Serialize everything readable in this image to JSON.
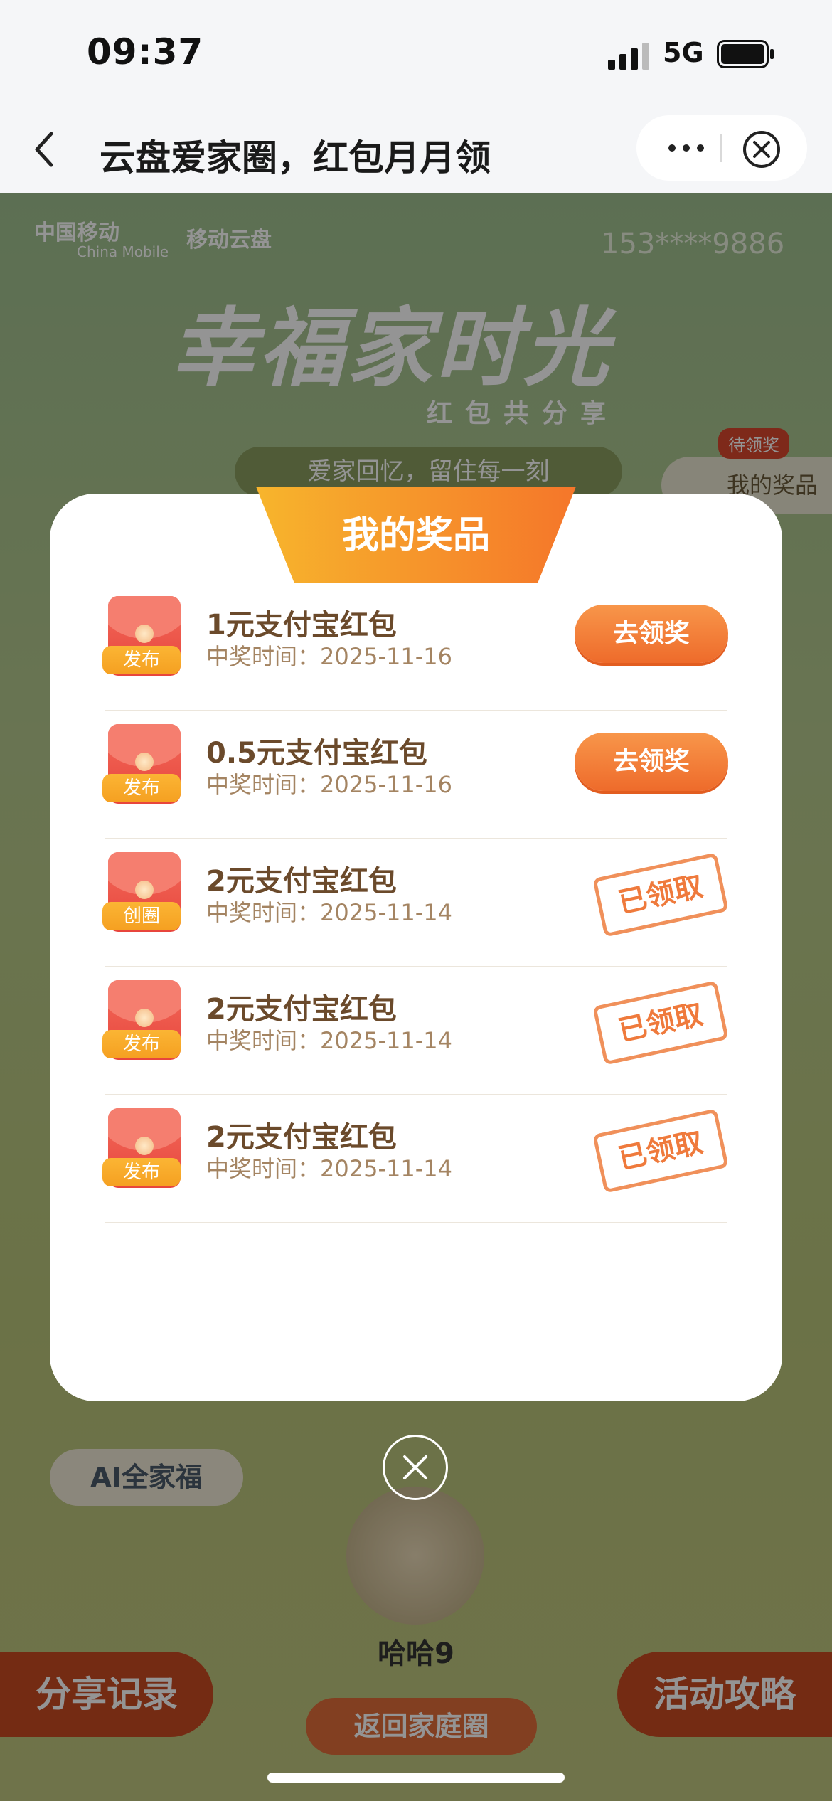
{
  "status_bar": {
    "time": "09:37",
    "network": "5G"
  },
  "nav": {
    "title": "云盘爱家圈，红包月月领"
  },
  "background": {
    "logo_main": "中国移动",
    "logo_main_en": "China Mobile",
    "logo_app": "移动云盘",
    "phone": "153****9886",
    "hero_title": "幸福家时光",
    "hero_subtitle": "红包共分享",
    "memory_banner": "爱家回忆，留住每一刻",
    "prize_tag": "待领奖",
    "prize_entry": "我的奖品",
    "ai_button": "AI全家福",
    "avatar_name": "哈哈9",
    "share_button": "分享记录",
    "guide_button": "活动攻略",
    "return_button": "返回家庭圈"
  },
  "modal": {
    "title": "我的奖品",
    "items": [
      {
        "tag": "发布",
        "name": "1元支付宝红包",
        "time": "中奖时间：2025-11-16",
        "action": "去领奖"
      },
      {
        "tag": "发布",
        "name": "0.5元支付宝红包",
        "time": "中奖时间：2025-11-16",
        "action": "去领奖"
      },
      {
        "tag": "创圈",
        "name": "2元支付宝红包",
        "time": "中奖时间：2025-11-14",
        "status": "已领取"
      },
      {
        "tag": "发布",
        "name": "2元支付宝红包",
        "time": "中奖时间：2025-11-14",
        "status": "已领取"
      },
      {
        "tag": "发布",
        "name": "2元支付宝红包",
        "time": "中奖时间：2025-11-14",
        "status": "已领取"
      }
    ]
  },
  "icons": [
    "back-arrow-icon",
    "more-dots-icon",
    "close-mini-program-icon",
    "signal-icon",
    "battery-icon",
    "close-icon"
  ],
  "colors": {
    "accent": "#f5762a",
    "header_gradient_start": "#f7b52c",
    "text_brown": "#6b4a2b"
  }
}
